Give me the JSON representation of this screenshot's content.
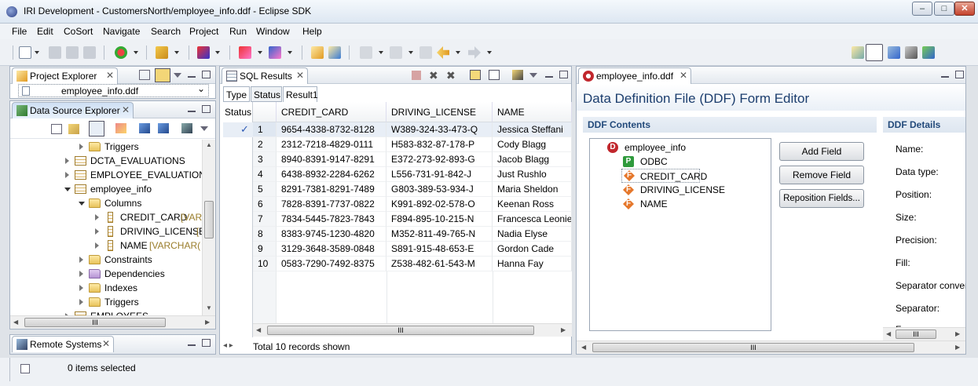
{
  "window": {
    "title": "IRI Development - CustomersNorth/employee_info.ddf - Eclipse SDK"
  },
  "menu": [
    "File",
    "Edit",
    "CoSort",
    "Navigate",
    "Search",
    "Project",
    "Run",
    "Window",
    "Help"
  ],
  "project_explorer": {
    "tab": "Project Explorer",
    "file": "employee_info.ddf"
  },
  "data_source_explorer": {
    "tab": "Data Source Explorer",
    "tree": [
      {
        "label": "Triggers",
        "kind": "folder"
      },
      {
        "label": "DCTA_EVALUATIONS",
        "kind": "table"
      },
      {
        "label": "EMPLOYEE_EVALUATIONS",
        "kind": "table"
      },
      {
        "label": "employee_info",
        "kind": "table"
      },
      {
        "label": "Columns",
        "kind": "folder"
      },
      {
        "label": "CREDIT_CARD",
        "type": "[VARC",
        "kind": "column"
      },
      {
        "label": "DRIVING_LICENSE",
        "type": "[",
        "kind": "column"
      },
      {
        "label": "NAME",
        "type": "[VARCHAR(",
        "kind": "column"
      },
      {
        "label": "Constraints",
        "kind": "folder"
      },
      {
        "label": "Dependencies",
        "kind": "folder-purple"
      },
      {
        "label": "Indexes",
        "kind": "folder"
      },
      {
        "label": "Triggers",
        "kind": "folder"
      },
      {
        "label": "EMPLOYEES",
        "kind": "table"
      }
    ],
    "hscroll_grip": "III"
  },
  "remote_systems": {
    "tab": "Remote Systems"
  },
  "sql_results": {
    "tab": "SQL Results",
    "side_tabs": [
      "Type",
      "Status"
    ],
    "result_tab": "Result1",
    "status_col": "Status",
    "columns": [
      "CREDIT_CARD",
      "DRIVING_LICENSE",
      "NAME"
    ],
    "check": "✓",
    "rows": [
      [
        "1",
        "9654-4338-8732-8128",
        "W389-324-33-473-Q",
        "Jessica Steffani"
      ],
      [
        "2",
        "2312-7218-4829-0111",
        "H583-832-87-178-P",
        "Cody Blagg"
      ],
      [
        "3",
        "8940-8391-9147-8291",
        "E372-273-92-893-G",
        "Jacob Blagg"
      ],
      [
        "4",
        "6438-8932-2284-6262",
        "L556-731-91-842-J",
        "Just Rushlo"
      ],
      [
        "5",
        "8291-7381-8291-7489",
        "G803-389-53-934-J",
        "Maria Sheldon"
      ],
      [
        "6",
        "7828-8391-7737-0822",
        "K991-892-02-578-O",
        "Keenan Ross"
      ],
      [
        "7",
        "7834-5445-7823-7843",
        "F894-895-10-215-N",
        "Francesca Leonie"
      ],
      [
        "8",
        "8383-9745-1230-4820",
        "M352-811-49-765-N",
        "Nadia Elyse"
      ],
      [
        "9",
        "3129-3648-3589-0848",
        "S891-915-48-653-E",
        "Gordon Cade"
      ],
      [
        "10",
        "0583-7290-7492-8375",
        "Z538-482-61-543-M",
        "Hanna Fay"
      ]
    ],
    "hscroll_grip": "III",
    "footer": "Total 10 records shown"
  },
  "ddf_editor": {
    "tab": "employee_info.ddf",
    "heading": "Data Definition File (DDF) Form Editor",
    "contents_title": "DDF Contents",
    "details_title": "DDF Details",
    "tree": [
      {
        "label": "employee_info",
        "icon": "D"
      },
      {
        "label": "ODBC",
        "icon": "P"
      },
      {
        "label": "CREDIT_CARD",
        "icon": "F"
      },
      {
        "label": "DRIVING_LICENSE",
        "icon": "F"
      },
      {
        "label": "NAME",
        "icon": "F"
      }
    ],
    "buttons": {
      "add": "Add Field",
      "remove": "Remove Field",
      "reposition": "Reposition Fields..."
    },
    "details": [
      "Name:",
      "Data type:",
      "Position:",
      "Size:",
      "Precision:",
      "Fill:",
      "Separator conver",
      "Separator:",
      "F"
    ],
    "grip": "III"
  },
  "status": {
    "text": "0 items selected"
  }
}
